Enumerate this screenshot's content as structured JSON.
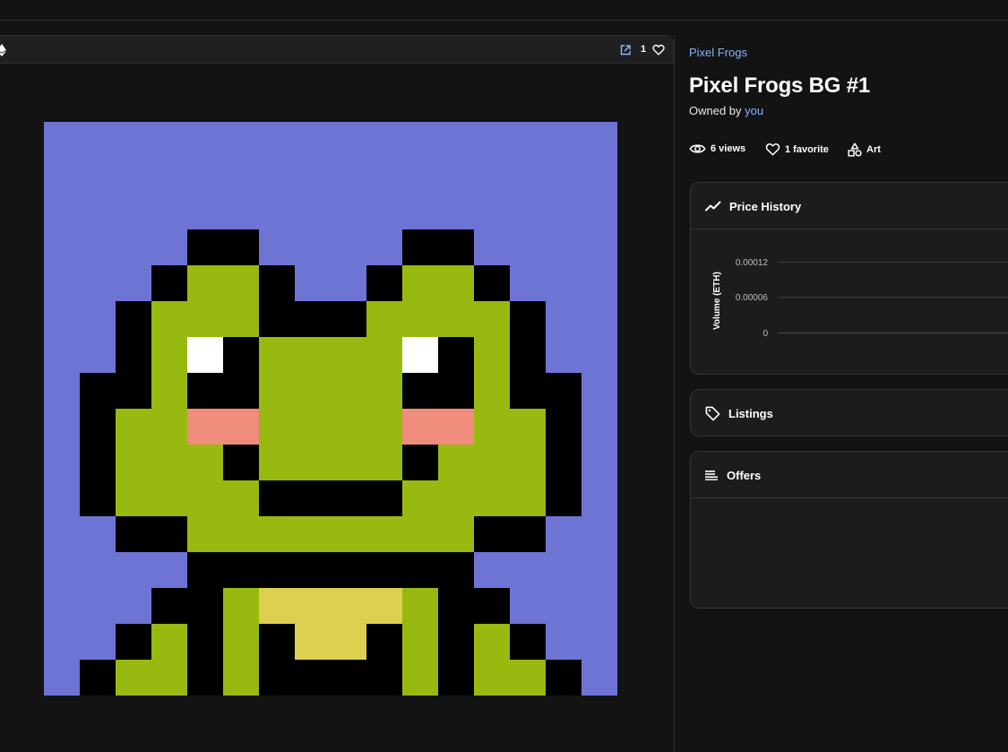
{
  "item": {
    "collection": "Pixel Frogs",
    "title": "Pixel Frogs BG #1",
    "owned_by_label": "Owned by",
    "owner": "you",
    "favorites_count": "1"
  },
  "stats": {
    "views": "6 views",
    "favorites": "1 favorite",
    "category": "Art"
  },
  "price_history": {
    "title": "Price History",
    "y_axis_label": "Volume (ETH)",
    "ticks": [
      "0.00012",
      "0.00006",
      "0"
    ]
  },
  "listings": {
    "title": "Listings"
  },
  "offers": {
    "title": "Offers"
  },
  "colors": {
    "background": "#6e74d4",
    "skin": "#98b90f",
    "outline": "#000000",
    "eye_white": "#ffffff",
    "cheek": "#f08c7c",
    "belly": "#dcd050",
    "link": "#8ab4f8"
  },
  "icons": {
    "network": "ethereum-icon",
    "open": "open-external-icon",
    "favorite": "heart-icon",
    "views": "eye-icon",
    "category": "shapes-icon",
    "price_history": "trending-line-icon",
    "listings": "tag-icon",
    "offers": "list-icon"
  }
}
